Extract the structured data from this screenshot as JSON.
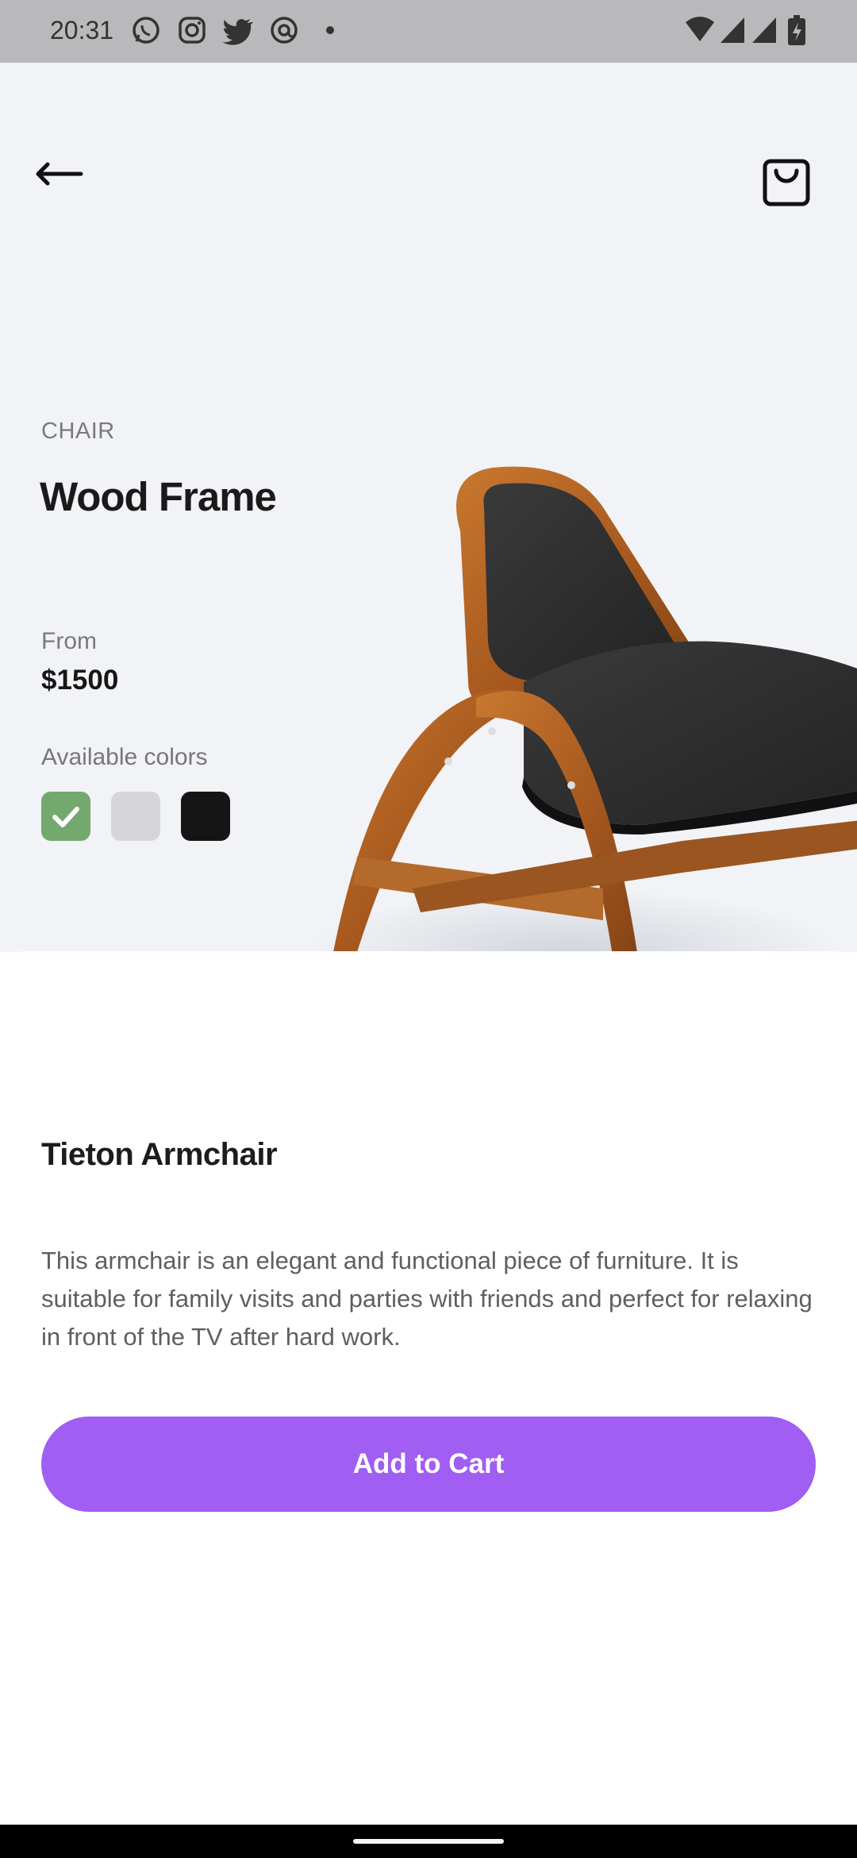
{
  "status_bar": {
    "time": "20:31",
    "notification_icons": [
      "whatsapp-icon",
      "instagram-icon",
      "twitter-icon",
      "at-sign-icon",
      "dot-icon"
    ],
    "system_icons": [
      "wifi-icon",
      "signal-icon",
      "signal-icon",
      "battery-charging-icon"
    ]
  },
  "header": {
    "back_icon": "arrow-left-icon",
    "cart_icon": "shopping-bag-icon"
  },
  "product": {
    "category": "CHAIR",
    "title": "Wood Frame",
    "price_label": "From",
    "price": "$1500",
    "colors_label": "Available colors",
    "colors": [
      {
        "name": "green",
        "hex": "#73a86e",
        "selected": true
      },
      {
        "name": "light-grey",
        "hex": "#d6d6d8",
        "selected": false
      },
      {
        "name": "black",
        "hex": "#151515",
        "selected": false
      }
    ],
    "name": "Tieton Armchair",
    "description": "This armchair is an elegant and functional piece of furniture. It is suitable for family visits and parties with friends and perfect for relaxing in front of the TV after hard work.",
    "add_to_cart_label": "Add to Cart"
  },
  "colors": {
    "accent": "#a05ef2",
    "hero_background": "#f1f3f6"
  }
}
